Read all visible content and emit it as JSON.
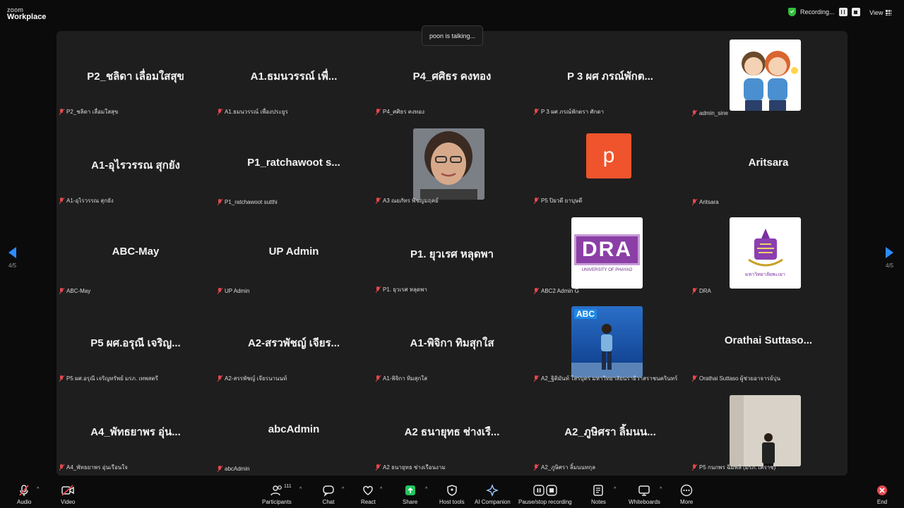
{
  "app": {
    "brand_top": "zoom",
    "brand_bottom": "Workplace"
  },
  "recording": {
    "label": "Recording..."
  },
  "view": {
    "label": "View"
  },
  "talking": {
    "text": "poon is talking..."
  },
  "pager": {
    "left": "4/5",
    "right": "4/5"
  },
  "tiles": [
    {
      "big": "P2_ชลิดา เลื่อมใสสุข",
      "label": "P2_ชลิดา เลื่อมใสสุข"
    },
    {
      "big": "A1.ธมนวรรณ์ เพื่...",
      "label": "A1.ธมนวรรณ์ เพื่องประยูร"
    },
    {
      "big": "P4_ศศิธร คงทอง",
      "label": "P4_ศศิธร คงทอง"
    },
    {
      "big": "P 3 ผศ ภรณ์พักต...",
      "label": "P 3 ผศ ภรณ์พักตรา ศักดา"
    },
    {
      "big": "",
      "label": "admin_sine",
      "avatar": "cartoon"
    },
    {
      "big": "A1-อุไรวรรณ สุกยัง",
      "label": "A1-อุไรวรรณ สุกยัง"
    },
    {
      "big": "P1_ratchawoot s...",
      "label": "P1_ratchawoot sutthi"
    },
    {
      "big": "",
      "label": "A3 ณยภัทร พิชญมฤคย์",
      "avatar": "photo-woman"
    },
    {
      "big": "",
      "label": "P5 ปิยวดี ยาบุษดี",
      "avatar": "letter",
      "letter": "p"
    },
    {
      "big": "Aritsara",
      "label": "Aritsara"
    },
    {
      "big": "ABC-May",
      "label": "ABC-May"
    },
    {
      "big": "UP  Admin",
      "label": "UP  Admin"
    },
    {
      "big": "P1. ยุวเรศ  หลุดพา",
      "label": "P1. ยุวเรศ  หลุดพา"
    },
    {
      "big": "",
      "label": "ABC2 Admin G",
      "avatar": "dra-logo",
      "logo_text": "DRA",
      "logo_sub": "UNIVERSITY OF PHAYAO"
    },
    {
      "big": "",
      "label": "DRA",
      "avatar": "up-logo",
      "logo_text": "มหาวิทยาลัยพะเยา"
    },
    {
      "big": "P5 ผศ.อรุณี เจริญ...",
      "label": "P5 ผศ.อรุณี เจริญทรัพย์ มรภ. เทพสตรี"
    },
    {
      "big": "A2-สรวพัชญ์ เจียร...",
      "label": "A2-สรรพัชญ์ เจียรนานนท์"
    },
    {
      "big": "A1-พิจิกา ทิมสุกใส",
      "label": "A1-พิจิกา ทิมสุกใส"
    },
    {
      "big": "",
      "label": "A2_ฐิติมันท์ โสรบุตร มหาวิทยาลัยนราธิวาสราชนครินทร์",
      "avatar": "abc-poster",
      "logo_text": "ABC"
    },
    {
      "big": "Orathai  Suttaso...",
      "label": "Orathai Suttaso  ผู้ช่วยอาจารย์บุ่น"
    },
    {
      "big": "A4_พัทธยาพร อุ่น...",
      "label": "A4_พัทธยาพร อุ่นเรือนใจ"
    },
    {
      "big": "abcAdmin",
      "label": "abcAdmin"
    },
    {
      "big": "A2 ธนายุทธ ช่างเรื...",
      "label": "A2 ธนายุทธ ช่างเรือนงาม"
    },
    {
      "big": "A2_ภูษิศรา ลิ้มนน...",
      "label": "A2_ภูษิศรา ลิ้มนนทกุล"
    },
    {
      "big": "",
      "label": "P5 กนกพร ฉิมพลี (มรภ.โคราช)",
      "avatar": "photo-suit"
    }
  ],
  "toolbar": {
    "audio": "Audio",
    "video": "Video",
    "participants": "Participants",
    "participants_count": "111",
    "chat": "Chat",
    "react": "React",
    "share": "Share",
    "host_tools": "Host tools",
    "ai": "AI Companion",
    "recording": "Pause/stop recording",
    "notes": "Notes",
    "whiteboards": "Whiteboards",
    "more": "More",
    "end": "End"
  }
}
